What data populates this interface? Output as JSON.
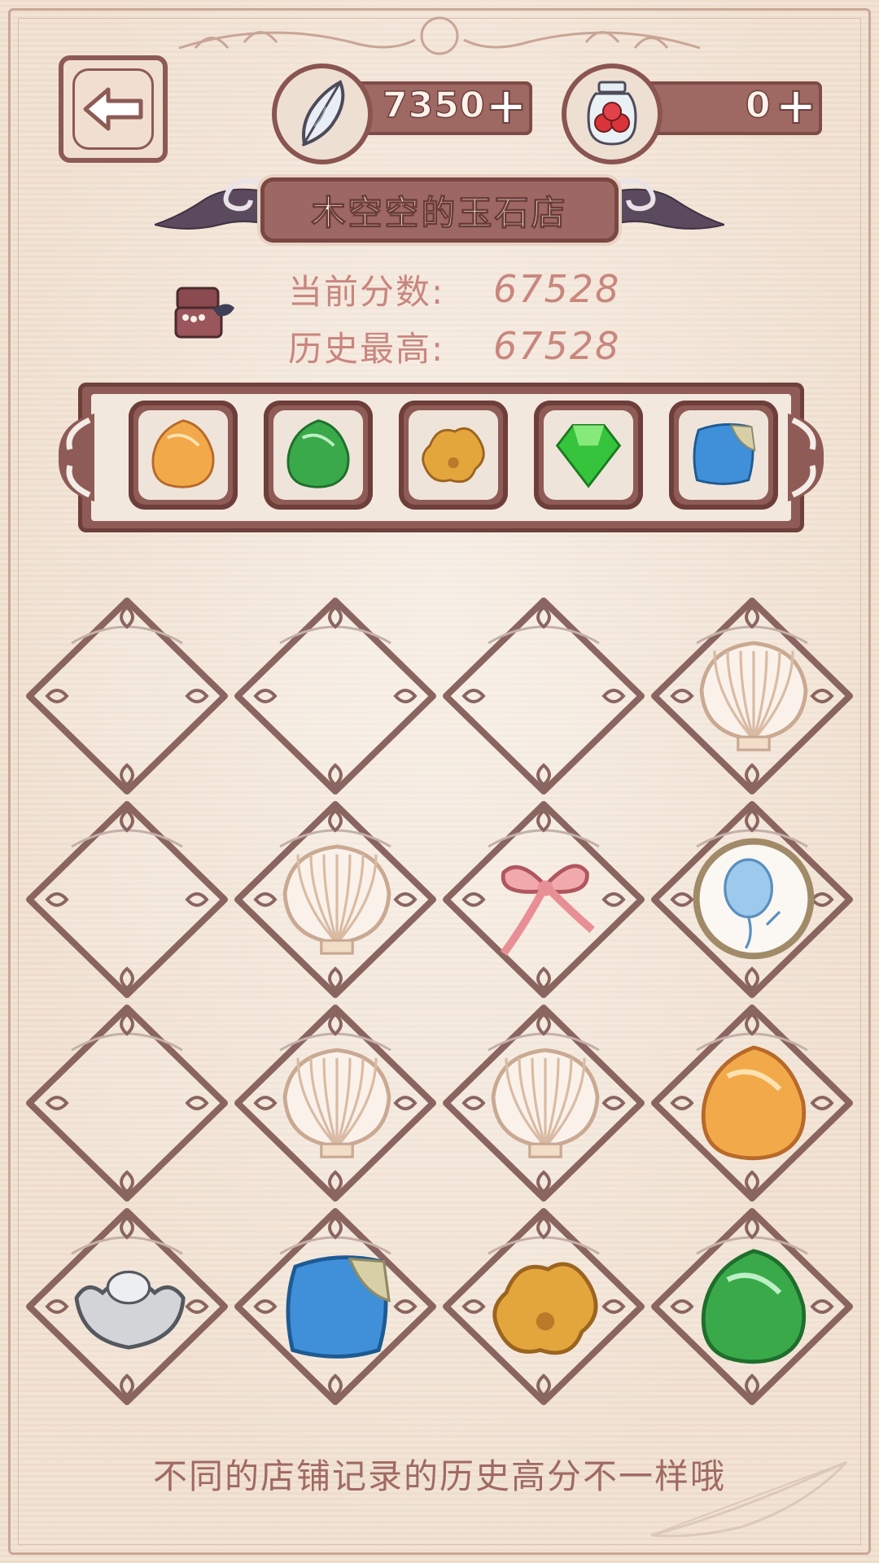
{
  "header": {
    "back_icon": "arrow-left-icon",
    "currency_feather": {
      "icon": "feather-icon",
      "value": "7350",
      "plus": "+"
    },
    "currency_jar": {
      "icon": "berry-jar-icon",
      "value": "0",
      "plus": "+"
    }
  },
  "shop": {
    "title": "木空空的玉石店",
    "icon": "jewelry-box-icon"
  },
  "scores": {
    "current_label": "当前分数:",
    "current_value": "67528",
    "best_label": "历史最高:",
    "best_value": "67528"
  },
  "target_gems": [
    {
      "name": "amber-gem",
      "color": "#f0a640"
    },
    {
      "name": "jade-gem",
      "color": "#3fae4c"
    },
    {
      "name": "gold-nugget",
      "color": "#e0a43a"
    },
    {
      "name": "emerald-crystal",
      "color": "#37c43c"
    },
    {
      "name": "sapphire-stone",
      "color": "#3b8fd8"
    }
  ],
  "board": {
    "rows": [
      [
        "empty",
        "empty",
        "empty",
        "shell"
      ],
      [
        "empty",
        "shell",
        "ribbon",
        "balloon-token"
      ],
      [
        "empty",
        "shell",
        "shell",
        "amber-gem"
      ],
      [
        "silver-ingot",
        "sapphire-stone",
        "gold-nugget",
        "jade-gem"
      ]
    ]
  },
  "hint": "不同的店铺记录的历史高分不一样哦",
  "colors": {
    "frame": "#8f5b56",
    "text_score": "#c9867e",
    "background": "#f1e2d2"
  }
}
